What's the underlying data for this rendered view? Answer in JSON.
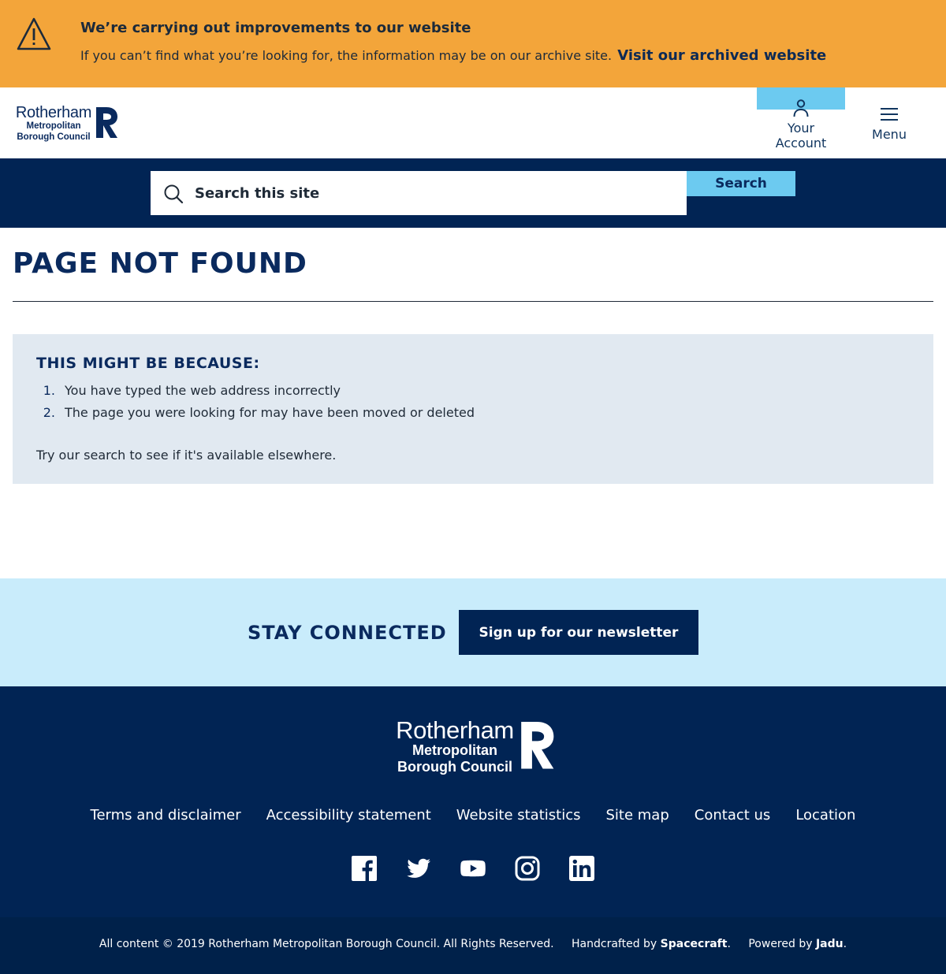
{
  "alert": {
    "title": "We’re carrying out improvements to our website",
    "body": "If you can’t find what you’re looking for, the information may be on our archive site.",
    "link": "Visit our archived website",
    "icon": "warning-icon"
  },
  "header": {
    "logo": {
      "line1": "Rotherham",
      "line2": "Metropolitan",
      "line3": "Borough Council"
    },
    "account_label": "Your\nAccount",
    "menu_label": "Menu"
  },
  "search": {
    "placeholder": "Search this site",
    "button": "Search"
  },
  "main": {
    "title": "PAGE NOT FOUND",
    "panel_heading": "THIS MIGHT BE BECAUSE:",
    "reasons": [
      {
        "num": "1.",
        "text": "You have typed the web address incorrectly"
      },
      {
        "num": "2.",
        "text": "The page you were looking for may have been moved or deleted"
      }
    ],
    "note": "Try our search to see if it's available elsewhere."
  },
  "stay_connected": {
    "title": "STAY CONNECTED",
    "button": "Sign up for our newsletter"
  },
  "footer": {
    "links": [
      "Terms and disclaimer",
      "Accessibility statement",
      "Website statistics",
      "Site map",
      "Contact us",
      "Location"
    ],
    "social": [
      "facebook-icon",
      "twitter-icon",
      "youtube-icon",
      "instagram-icon",
      "linkedin-icon"
    ]
  },
  "bottom": {
    "copyright": "All content © 2019 Rotherham Metropolitan Borough Council. All Rights Reserved.",
    "handcrafted_prefix": "Handcrafted by",
    "handcrafted_by": "Spacecraft",
    "powered_prefix": "Powered by",
    "powered_by": "Jadu"
  },
  "colors": {
    "alert_bg": "#f3a53a",
    "navy": "#012454",
    "light_blue": "#6ccaf0",
    "panel_bg": "#e1e9f1",
    "stay_bg": "#c9ecfb"
  }
}
